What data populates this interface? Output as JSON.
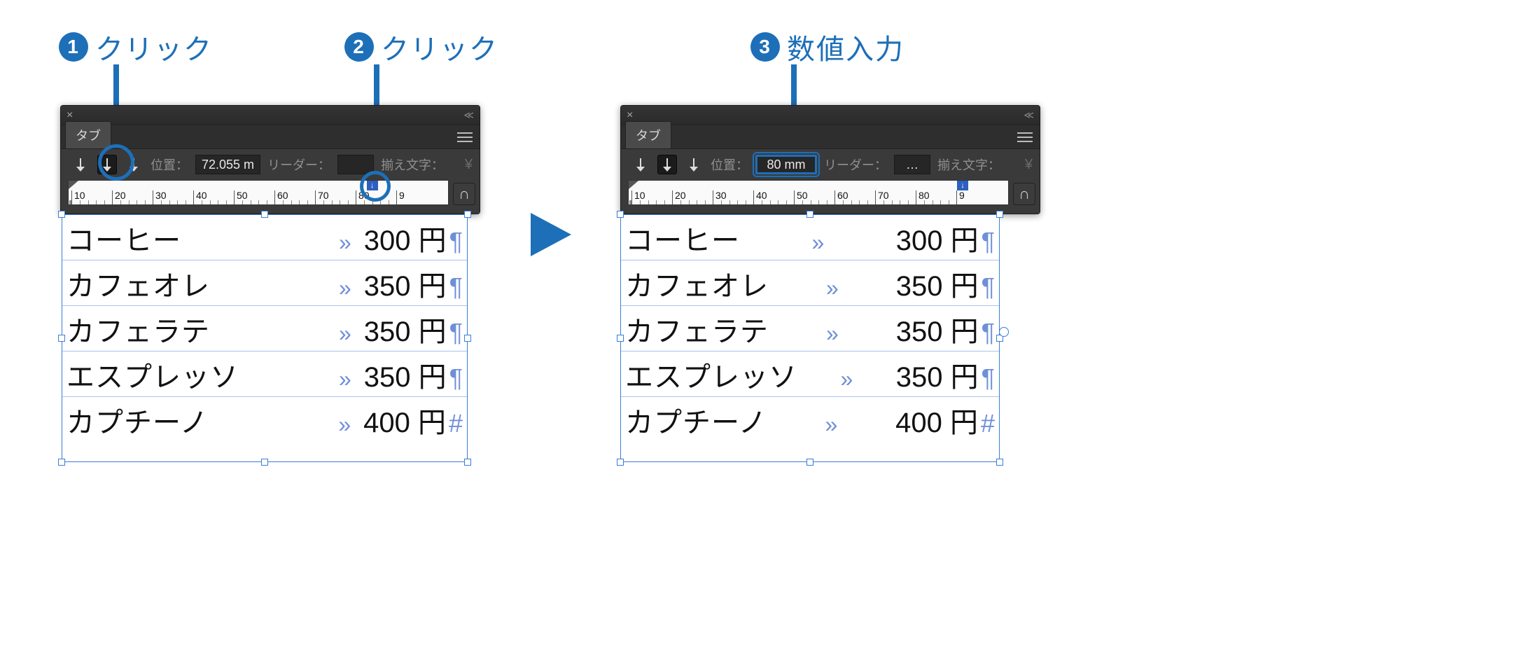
{
  "callouts": {
    "c1": {
      "num": "1",
      "label": "クリック"
    },
    "c2": {
      "num": "2",
      "label": "クリック"
    },
    "c3": {
      "num": "3",
      "label": "数値入力"
    }
  },
  "panel_left": {
    "tab_label": "タブ",
    "position_label": "位置：",
    "position_value": "72.055 m",
    "leader_label": "リーダー：",
    "leader_value": "",
    "align_label": "揃え文字：",
    "align_sym": "¥",
    "ruler_numbers": [
      "",
      "10",
      "20",
      "30",
      "40",
      "50",
      "60",
      "70",
      "80"
    ],
    "tab_stop_left_pct": 80
  },
  "panel_right": {
    "tab_label": "タブ",
    "position_label": "位置：",
    "position_value": "80 mm",
    "leader_label": "リーダー：",
    "leader_value": "…",
    "align_label": "揃え文字：",
    "align_sym": "¥",
    "ruler_numbers": [
      "",
      "10",
      "20",
      "30",
      "40",
      "50",
      "60",
      "70",
      "80"
    ],
    "tab_stop_left_pct": 88
  },
  "menu_items": [
    {
      "name": "コーヒー",
      "price": "300 円",
      "end": "¶"
    },
    {
      "name": "カフェオレ",
      "price": "350 円",
      "end": "¶"
    },
    {
      "name": "カフェラテ",
      "price": "350 円",
      "end": "¶"
    },
    {
      "name": "エスプレッソ",
      "price": "350 円",
      "end": "¶"
    },
    {
      "name": "カプチーノ",
      "price": "400 円",
      "end": "#"
    }
  ],
  "tab_glyph": "»"
}
